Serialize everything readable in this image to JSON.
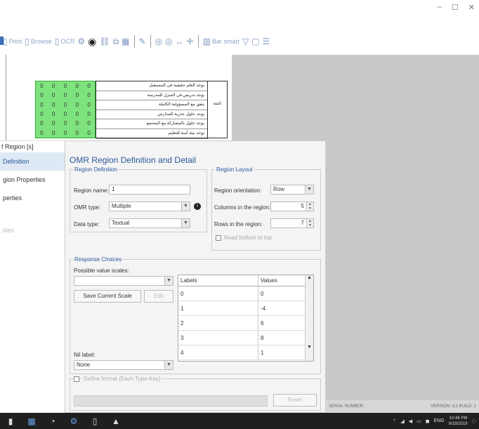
{
  "window": {
    "minimize": "–",
    "maximize": "☐",
    "close": "✕"
  },
  "toolbar": {
    "items": [
      {
        "label": "Print",
        "icon": "page-icon"
      },
      {
        "label": "Browse",
        "icon": "page-icon"
      },
      {
        "label": "OCR",
        "icon": "page-icon"
      },
      {
        "label": "",
        "icon": "settings-icon"
      },
      {
        "label": "",
        "icon": "omr-circle-icon"
      }
    ],
    "smart_label": "Bar smart"
  },
  "document": {
    "omr_digits": [
      "0",
      "0",
      "0",
      "0",
      "0",
      "0",
      "0",
      "0",
      "0",
      "0",
      "0",
      "0",
      "0",
      "0",
      "0",
      "0",
      "0",
      "0",
      "0",
      "0",
      "0",
      "0",
      "0",
      "0",
      "0",
      "0",
      "0",
      "0",
      "0",
      "0"
    ],
    "rows": [
      "يوجد العلم حقيقية في المستقبل",
      "يوجد تدريس في المنزل للمدرسة",
      "يتفق مع المسؤولية الكاملة",
      "يوجد حلول جذرية للمدارس",
      "يوجد حلول بالمشاركة مع المجتمع",
      "يوجد بيئة آمنة للتعليم"
    ],
    "side_label": "الفئة"
  },
  "side_nav": {
    "header": "f Region [s]",
    "items": [
      {
        "label": "Definition",
        "active": true
      },
      {
        "label": "gion Properties",
        "active": false
      },
      {
        "label": "perties",
        "active": false
      },
      {
        "label": "ities",
        "active": false,
        "dim": true
      }
    ]
  },
  "dialog": {
    "title": "OMR Region Definition and Detail",
    "region_definition": {
      "legend": "Region Definition",
      "name_label": "Region name:",
      "name_value": "1",
      "omr_type_label": "OMR type:",
      "omr_type_value": "Multiple",
      "data_type_label": "Data type:",
      "data_type_value": "Textual"
    },
    "region_layout": {
      "legend": "Region Layout",
      "orientation_label": "Region orientation:",
      "orientation_value": "Row",
      "columns_label": "Columns in the region:",
      "columns_value": "5",
      "rows_label": "Rows in the region:",
      "rows_value": "7",
      "checkbox_label": "Read bottom to top"
    },
    "response_choices": {
      "legend": "Response Choices",
      "scales_label": "Possible value scales:",
      "save_scale_button": "Save Current Scale",
      "edit_button": "Edit",
      "nil_label": "Nil label:",
      "nil_value": "None",
      "table_headers": {
        "labels": "Labels",
        "values": "Values"
      },
      "rows": [
        {
          "label": "0",
          "value": "0"
        },
        {
          "label": "1",
          "value": "-4"
        },
        {
          "label": "2",
          "value": "6"
        },
        {
          "label": "3",
          "value": "8"
        },
        {
          "label": "4",
          "value": "1"
        }
      ]
    },
    "define_format": {
      "label": "Define format (Each Type-Key)",
      "button": "Reset"
    }
  },
  "status_bar": {
    "serial": "SERIAL NUMBER:",
    "version": "VERSION: 3.2 BUILD: 2"
  },
  "taskbar": {
    "lang": "ENG",
    "time": "10:46 PM",
    "date": "9/19/2019"
  }
}
